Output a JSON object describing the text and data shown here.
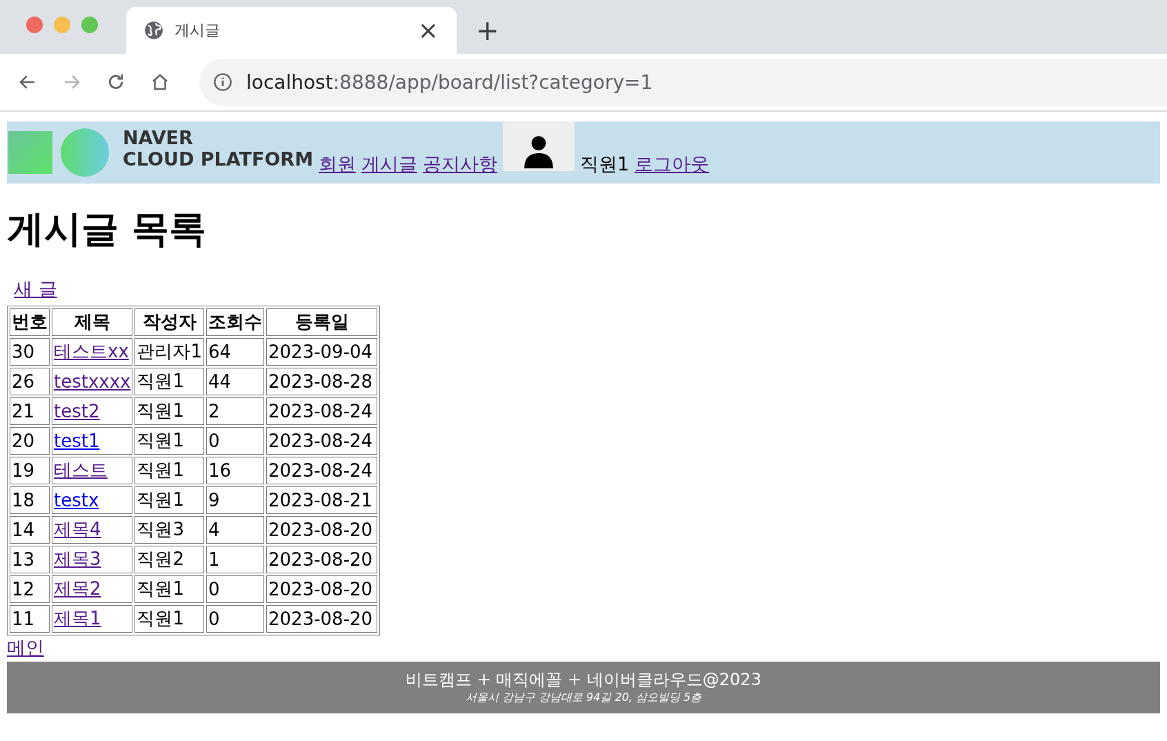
{
  "browser": {
    "tab_title": "게시글",
    "close_glyph": "×",
    "new_tab_glyph": "+",
    "url_host": "localhost",
    "url_rest": ":8888/app/board/list?category=1"
  },
  "header": {
    "logo_line1": "NAVER",
    "logo_line2": "CLOUD PLATFORM",
    "nav": [
      {
        "label": "회원",
        "visited": true
      },
      {
        "label": "게시글",
        "visited": true
      },
      {
        "label": "공지사항",
        "visited": true
      }
    ],
    "user_name": "직원1",
    "logout": {
      "label": "로그아웃",
      "visited": true
    }
  },
  "page_title": "게시글 목록",
  "new_post": {
    "label": "새 글",
    "visited": true
  },
  "table": {
    "columns": [
      "번호",
      "제목",
      "작성자",
      "조회수",
      "등록일"
    ],
    "rows": [
      {
        "no": "30",
        "title": "테스트xx",
        "visited": true,
        "writer": "관리자1",
        "views": "64",
        "date": "2023-09-04"
      },
      {
        "no": "26",
        "title": "testxxxx",
        "visited": true,
        "writer": "직원1",
        "views": "44",
        "date": "2023-08-28"
      },
      {
        "no": "21",
        "title": "test2",
        "visited": true,
        "writer": "직원1",
        "views": "2",
        "date": "2023-08-24"
      },
      {
        "no": "20",
        "title": "test1",
        "visited": false,
        "writer": "직원1",
        "views": "0",
        "date": "2023-08-24"
      },
      {
        "no": "19",
        "title": "테스트",
        "visited": true,
        "writer": "직원1",
        "views": "16",
        "date": "2023-08-24"
      },
      {
        "no": "18",
        "title": "testx",
        "visited": false,
        "writer": "직원1",
        "views": "9",
        "date": "2023-08-21"
      },
      {
        "no": "14",
        "title": "제목4",
        "visited": true,
        "writer": "직원3",
        "views": "4",
        "date": "2023-08-20"
      },
      {
        "no": "13",
        "title": "제목3",
        "visited": true,
        "writer": "직원2",
        "views": "1",
        "date": "2023-08-20"
      },
      {
        "no": "12",
        "title": "제목2",
        "visited": true,
        "writer": "직원1",
        "views": "0",
        "date": "2023-08-20"
      },
      {
        "no": "11",
        "title": "제목1",
        "visited": true,
        "writer": "직원1",
        "views": "0",
        "date": "2023-08-20"
      }
    ]
  },
  "main_link": {
    "label": "메인",
    "visited": true
  },
  "footer": {
    "line1": "비트캠프 + 매직에꼴 + 네이버클라우드@2023",
    "line2": "서울시 강남구 강남대로 94길 20, 삼오빌딩 5층"
  }
}
